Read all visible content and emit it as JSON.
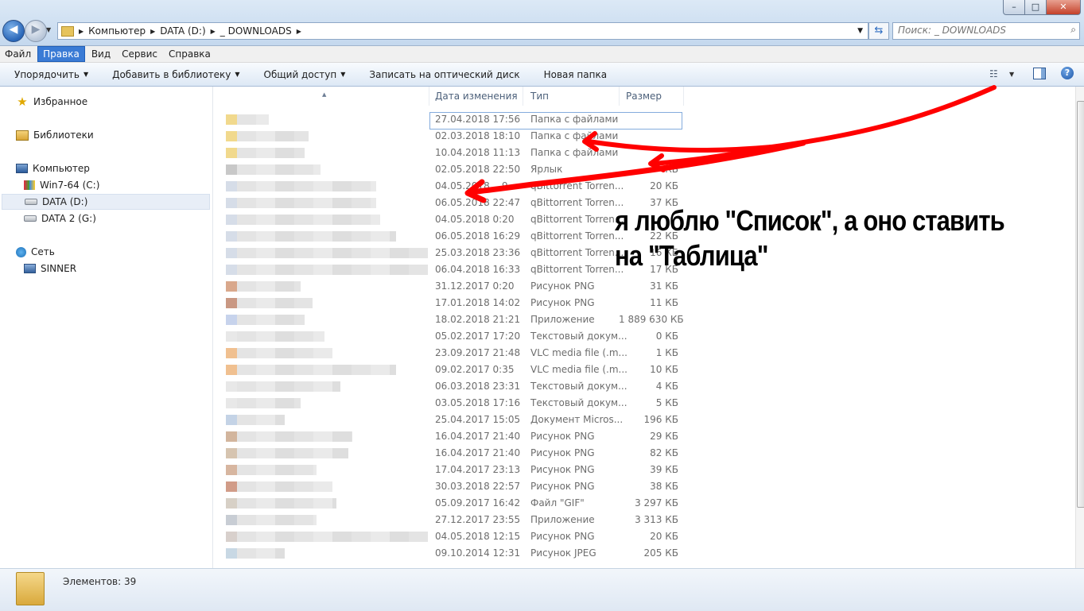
{
  "window": {
    "minimize": "–",
    "maximize": "□",
    "close": "✕"
  },
  "nav_buttons": {
    "back": "◀",
    "forward": "▶",
    "history": "▼"
  },
  "address": {
    "crumbs": [
      "Компьютер",
      "DATA (D:)",
      "_ DOWNLOADS"
    ]
  },
  "search": {
    "placeholder": "Поиск: _ DOWNLOADS"
  },
  "menu": [
    "Файл",
    "Правка",
    "Вид",
    "Сервис",
    "Справка"
  ],
  "menu_active_index": 1,
  "toolbar": {
    "organize": "Упорядочить",
    "add_to_library": "Добавить в библиотеку",
    "share": "Общий доступ",
    "burn": "Записать на оптический диск",
    "new_folder": "Новая папка"
  },
  "nav_pane": {
    "favorites": "Избранное",
    "libraries": "Библиотеки",
    "computer": "Компьютер",
    "drive_c": "Win7-64 (C:)",
    "drive_d": "DATA (D:)",
    "drive_g": "DATA 2 (G:)",
    "network": "Сеть",
    "network_pc": "SINNER"
  },
  "columns": {
    "date": "Дата изменения",
    "type": "Тип",
    "size": "Размер"
  },
  "files": [
    {
      "date": "27.04.2018 17:56",
      "type": "Папка с файлами",
      "size": ""
    },
    {
      "date": "02.03.2018 18:10",
      "type": "Папка с файлами",
      "size": ""
    },
    {
      "date": "10.04.2018 11:13",
      "type": "Папка с файлами",
      "size": ""
    },
    {
      "date": "02.05.2018 22:50",
      "type": "Ярлык",
      "size": "КБ"
    },
    {
      "date": "04.05.2018 ...9",
      "type": "qBittorrent Torren...",
      "size": "20 КБ"
    },
    {
      "date": "06.05.2018 22:47",
      "type": "qBittorrent Torren...",
      "size": "37 КБ"
    },
    {
      "date": "04.05.2018 0:20",
      "type": "qBittorrent Torren...",
      "size": ""
    },
    {
      "date": "06.05.2018 16:29",
      "type": "qBittorrent Torren...",
      "size": "22 КБ"
    },
    {
      "date": "25.03.2018 23:36",
      "type": "qBittorrent Torren...",
      "size": "16 КБ"
    },
    {
      "date": "06.04.2018 16:33",
      "type": "qBittorrent Torren...",
      "size": "17 КБ"
    },
    {
      "date": "31.12.2017 0:20",
      "type": "Рисунок PNG",
      "size": "31 КБ"
    },
    {
      "date": "17.01.2018 14:02",
      "type": "Рисунок PNG",
      "size": "11 КБ"
    },
    {
      "date": "18.02.2018 21:21",
      "type": "Приложение",
      "size": "1 889 630 КБ"
    },
    {
      "date": "05.02.2017 17:20",
      "type": "Текстовый докум...",
      "size": "0 КБ"
    },
    {
      "date": "23.09.2017 21:48",
      "type": "VLC media file (.m...",
      "size": "1 КБ"
    },
    {
      "date": "09.02.2017 0:35",
      "type": "VLC media file (.m...",
      "size": "10 КБ"
    },
    {
      "date": "06.03.2018 23:31",
      "type": "Текстовый докум...",
      "size": "4 КБ"
    },
    {
      "date": "03.05.2018 17:16",
      "type": "Текстовый докум...",
      "size": "5 КБ"
    },
    {
      "date": "25.04.2017 15:05",
      "type": "Документ Micros...",
      "size": "196 КБ"
    },
    {
      "date": "16.04.2017 21:40",
      "type": "Рисунок PNG",
      "size": "29 КБ"
    },
    {
      "date": "16.04.2017 21:40",
      "type": "Рисунок PNG",
      "size": "82 КБ"
    },
    {
      "date": "17.04.2017 23:13",
      "type": "Рисунок PNG",
      "size": "39 КБ"
    },
    {
      "date": "30.03.2018 22:57",
      "type": "Рисунок PNG",
      "size": "38 КБ"
    },
    {
      "date": "05.09.2017 16:42",
      "type": "Файл \"GIF\"",
      "size": "3 297 КБ"
    },
    {
      "date": "27.12.2017 23:55",
      "type": "Приложение",
      "size": "3 313 КБ"
    },
    {
      "date": "04.05.2018 12:15",
      "type": "Рисунок PNG",
      "size": "20 КБ"
    },
    {
      "date": "09.10.2014 12:31",
      "type": "Рисунок JPEG",
      "size": "205 КБ"
    }
  ],
  "status": {
    "items_count": "Элементов: 39"
  },
  "annotation": {
    "line1": "я люблю \"Список\", а оно ставить",
    "line2": "на \"Таблица\""
  },
  "colors": {
    "accent": "#3a7bd5",
    "arrow": "#ff0000"
  }
}
